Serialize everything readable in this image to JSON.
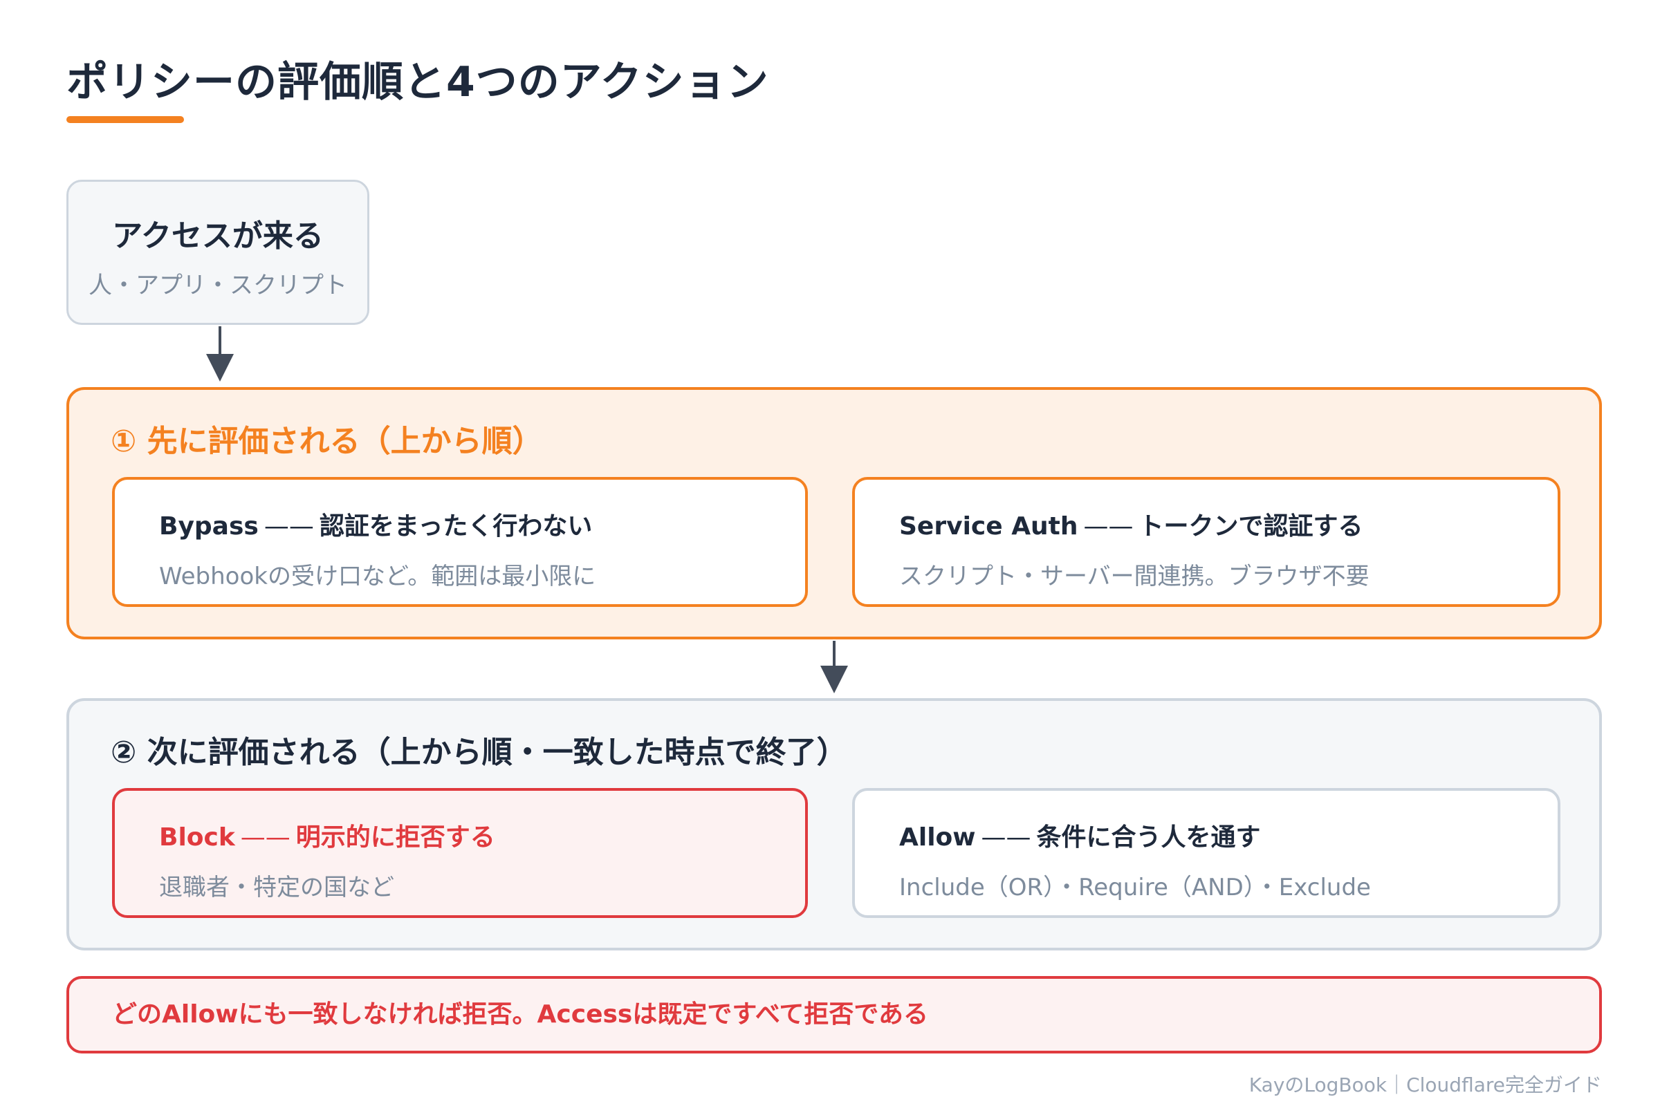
{
  "title": "ポリシーの評価順と4つのアクション",
  "start": {
    "title": "アクセスが来る",
    "subtitle": "人・アプリ・スクリプト"
  },
  "group1": {
    "title": "① 先に評価される（上から順）",
    "cards": [
      {
        "name": "Bypass",
        "dash": "——",
        "title": "認証をまったく行わない",
        "desc": "Webhookの受け口など。範囲は最小限に"
      },
      {
        "name": "Service Auth",
        "dash": "——",
        "title": "トークンで認証する",
        "desc": "スクリプト・サーバー間連携。ブラウザ不要"
      }
    ]
  },
  "group2": {
    "title": "② 次に評価される（上から順・一致した時点で終了）",
    "cards": [
      {
        "name": "Block",
        "dash": "——",
        "title": "明示的に拒否する",
        "desc": "退職者・特定の国など"
      },
      {
        "name": "Allow",
        "dash": "——",
        "title": "条件に合う人を通す",
        "desc": "Include（OR）・Require（AND）・Exclude"
      }
    ]
  },
  "note": "どのAllowにも一致しなければ拒否。Accessは既定ですべて拒否である",
  "footer": "KayのLogBook｜Cloudflare完全ガイド",
  "colors": {
    "accent": "#f48120",
    "deny": "#e03a3e",
    "neutral_border": "#cdd5de",
    "text_dark": "#1e293b",
    "text_muted": "#7d8b9c"
  }
}
